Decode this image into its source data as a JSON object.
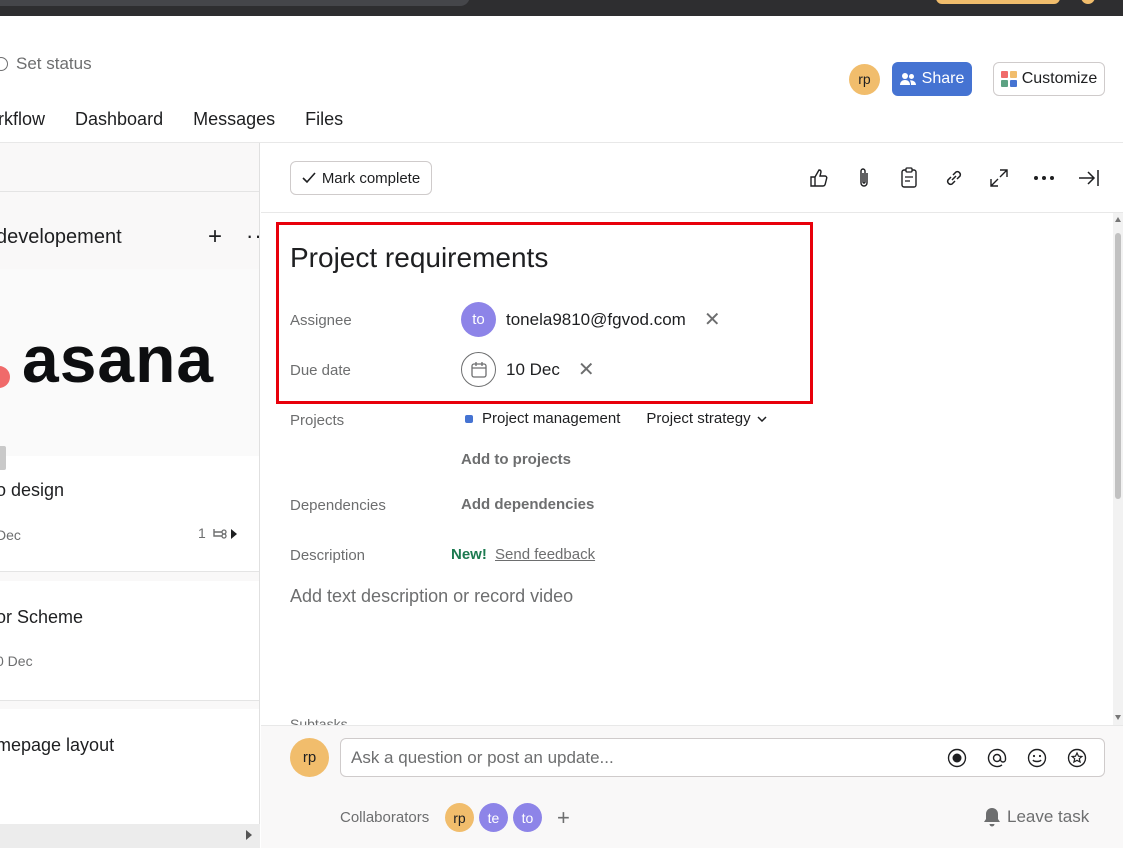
{
  "header": {
    "set_status": "Set status",
    "owner_avatar": "rp",
    "share_label": "Share",
    "customize_label": "Customize"
  },
  "nav": {
    "tabs": [
      {
        "label": "orkflow"
      },
      {
        "label": "Dashboard"
      },
      {
        "label": "Messages"
      },
      {
        "label": "Files"
      }
    ]
  },
  "board": {
    "column_title": "developement",
    "cards": [
      {
        "cover_text": "asana",
        "title": "o design",
        "date": "Dec",
        "subtasks": "1"
      },
      {
        "title": "or Scheme",
        "date": "0 Dec"
      },
      {
        "title": "mepage layout"
      }
    ]
  },
  "task": {
    "mark_complete_label": "Mark complete",
    "title": "Project requirements",
    "fields": {
      "assignee_label": "Assignee",
      "assignee_avatar": "to",
      "assignee_email": "tonela9810@fgvod.com",
      "due_label": "Due date",
      "due_value": "10 Dec",
      "projects_label": "Projects",
      "project_name": "Project management",
      "project_section": "Project strategy",
      "add_projects": "Add to projects",
      "dependencies_label": "Dependencies",
      "add_dependencies": "Add dependencies",
      "description_label": "Description",
      "new_badge": "New!",
      "send_feedback": "Send feedback",
      "description_placeholder": "Add text description or record video",
      "subtasks_label": "Subtasks"
    }
  },
  "comments": {
    "user_avatar": "rp",
    "placeholder": "Ask a question or post an update...",
    "collaborators_label": "Collaborators",
    "collaborators": [
      "rp",
      "te",
      "to"
    ],
    "leave_task": "Leave task"
  },
  "colors": {
    "share_blue": "#4573d2",
    "highlight_red": "#e8000b",
    "avatar_orange": "#f1bd6c",
    "avatar_purple": "#8d84e8",
    "new_green": "#1c7a50"
  }
}
